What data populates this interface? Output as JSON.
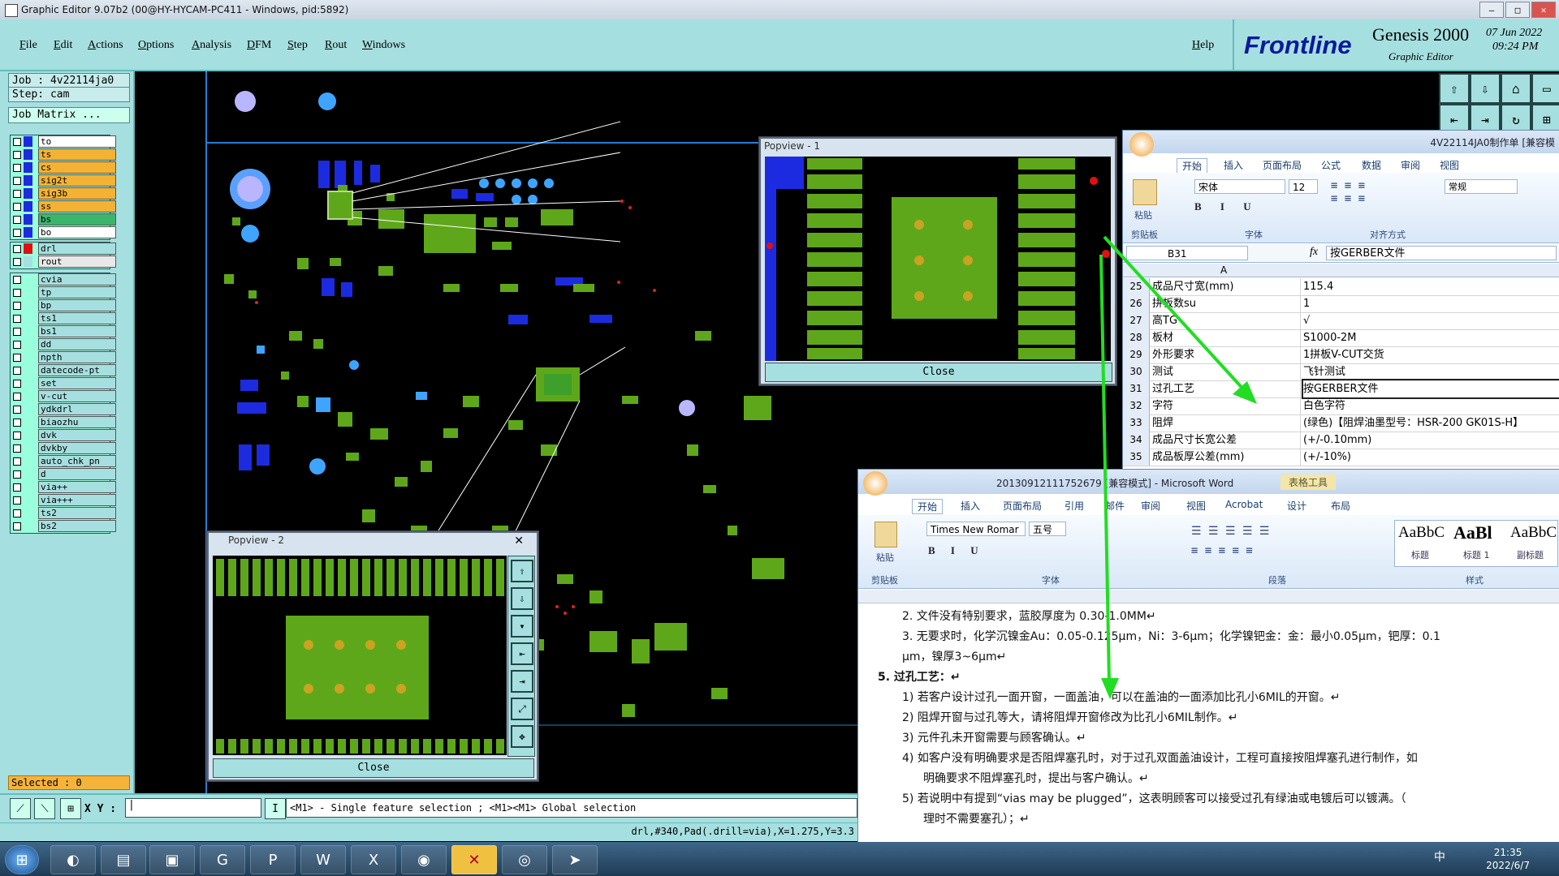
{
  "window": {
    "title": "Graphic Editor 9.07b2 (00@HY-HYCAM-PC411 - Windows, pid:5892)"
  },
  "menu": [
    "File",
    "Edit",
    "Actions",
    "Options",
    "Analysis",
    "DFM",
    "Step",
    "Rout",
    "Windows"
  ],
  "help_label": "Help",
  "brand": {
    "logo": "Frontline",
    "product": "Genesis 2000",
    "subtitle": "Graphic Editor",
    "date": "07  Jun  2022",
    "time": "09:24 PM"
  },
  "job": {
    "job_line": "Job : 4v22114ja0",
    "step_line": "Step: cam",
    "matrix_button": "Job Matrix ..."
  },
  "layers_top": [
    {
      "name": "to",
      "color": "#1d2be0",
      "bg": "#ffffff"
    },
    {
      "name": "ts",
      "color": "#1d2be0",
      "bg": "#f3b233"
    },
    {
      "name": "cs",
      "color": "#1d2be0",
      "bg": "#f3b233"
    },
    {
      "name": "sig2t",
      "color": "#1d2be0",
      "bg": "#f3b233"
    },
    {
      "name": "sig3b",
      "color": "#1d2be0",
      "bg": "#f3b233"
    },
    {
      "name": "ss",
      "color": "#1d2be0",
      "bg": "#f3b233"
    },
    {
      "name": "bs",
      "color": "#1d2be0",
      "bg": "#3bb56c"
    },
    {
      "name": "bo",
      "color": "#1d2be0",
      "bg": "#ffffff"
    }
  ],
  "layers_drill": [
    {
      "name": "drl",
      "color": "#e01010",
      "bg": "#a6dfe0"
    },
    {
      "name": "rout",
      "color": "#a6dfe0",
      "bg": "#e8e8e8"
    }
  ],
  "layers_other": [
    "cvia",
    "tp",
    "bp",
    "ts1",
    "bs1",
    "dd",
    "npth",
    "datecode-pt",
    "set",
    "v-cut",
    "ydkdrl",
    "biaozhu",
    "dvk",
    "dvkby",
    "auto_chk_pn",
    "d",
    "via++",
    "via+++",
    "ts2",
    "bs2"
  ],
  "selected_label": "Selected : 0",
  "bottom": {
    "xy_label": "X Y :",
    "hint": "<M1> - Single feature selection ; <M1><M1> Global selection",
    "status": "drl,#340,Pad(.drill=via),X=1.275,Y=3.3"
  },
  "popview1": {
    "title": "Popview - 1",
    "close": "Close"
  },
  "popview2": {
    "title": "Popview - 2",
    "close": "Close",
    "x": "✕"
  },
  "excel": {
    "title": "4V22114JA0制作单 [兼容模",
    "tabs": [
      "开始",
      "插入",
      "页面布局",
      "公式",
      "数据",
      "审阅",
      "视图"
    ],
    "font_name": "宋体",
    "font_size": "12",
    "number_format": "常规",
    "groups": [
      "剪贴板",
      "字体",
      "对齐方式"
    ],
    "paste": "粘贴",
    "cell_ref": "B31",
    "formula": "按GERBER文件",
    "col_a": "A",
    "rows": [
      {
        "n": "25",
        "a": "成品尺寸宽(mm)",
        "b": "115.4"
      },
      {
        "n": "26",
        "a": "拼板数su",
        "b": "1"
      },
      {
        "n": "27",
        "a": "高TG",
        "b": "√"
      },
      {
        "n": "28",
        "a": "板材",
        "b": "S1000-2M"
      },
      {
        "n": "29",
        "a": "外形要求",
        "b": "1拼板V-CUT交货"
      },
      {
        "n": "30",
        "a": "测试",
        "b": "飞针测试"
      },
      {
        "n": "31",
        "a": "过孔工艺",
        "b": "按GERBER文件"
      },
      {
        "n": "32",
        "a": "字符",
        "b": "白色字符"
      },
      {
        "n": "33",
        "a": "阻焊",
        "b": "(绿色)【阻焊油墨型号：HSR-200 GK01S-H】"
      },
      {
        "n": "34",
        "a": "成品尺寸长宽公差",
        "b": "(+/-0.10mm)"
      },
      {
        "n": "35",
        "a": "成品板厚公差(mm)",
        "b": "(+/-10%)"
      }
    ]
  },
  "word": {
    "title": "20130912111752679 [兼容模式] - Microsoft Word",
    "table_tools": "表格工具",
    "tabs": [
      "开始",
      "插入",
      "页面布局",
      "引用",
      "邮件",
      "审阅",
      "视图",
      "Acrobat",
      "设计",
      "布局"
    ],
    "font_name": "Times New Romar",
    "font_size": "五号",
    "groups": [
      "剪贴板",
      "字体",
      "段落",
      "样式"
    ],
    "paste": "粘贴",
    "styles": [
      {
        "sample": "AaBbC",
        "name": "标题"
      },
      {
        "sample": "AaBl",
        "name": "标题 1"
      },
      {
        "sample": "AaBbC",
        "name": "副标题"
      }
    ],
    "lines": [
      "2. 文件没有特别要求，蓝胶厚度为 0.30-1.0MM↵",
      "3. 无要求时，化学沉镍金Au：0.05-0.125μm，Ni：3-6μm；化学镍钯金：金：最小0.05μm，钯厚：0.1",
      "μm，镍厚3~6μm↵",
      "5.   过孔工艺：↵",
      "1) 若客户设计过孔一面开窗，一面盖油，可以在盖油的一面添加比孔小6MIL的开窗。↵",
      "2) 阻焊开窗与过孔等大，请将阻焊开窗修改为比孔小6MIL制作。↵",
      "3) 元件孔未开窗需要与顾客确认。↵",
      "4) 如客户没有明确要求是否阻焊塞孔时，对于过孔双面盖油设计，工程可直接按阻焊塞孔进行制作，如",
      "明确要求不阻焊塞孔时，提出与客户确认。↵",
      "5) 若说明中有提到“vias may be plugged”，这表明顾客可以接受过孔有绿油或电镀后可以镀满。（",
      "理时不需要塞孔）；↵"
    ]
  },
  "taskbar": {
    "clock_time": "21:35",
    "clock_date": "2022/6/7",
    "ime": "中"
  },
  "colors": {
    "panel": "#a6dfe0",
    "pad_green": "#5fa71a",
    "copper_blue": "#1d2be0",
    "annotation_arrow": "#22dd22"
  }
}
